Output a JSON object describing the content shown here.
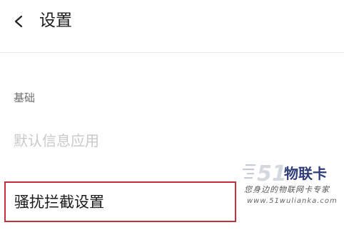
{
  "header": {
    "back_icon": "chevron-left-icon",
    "title": "设置"
  },
  "section": {
    "label": "基础"
  },
  "items": {
    "default_sms_app": "默认信息应用",
    "harassment_block": "骚扰拦截设置"
  },
  "watermark": {
    "brand": "51物联卡",
    "tagline": "您身边的物联网卡专家",
    "url": "www.51wulianka.com"
  },
  "colors": {
    "highlight_border": "#c0323a",
    "disabled_text": "#c9c9c9"
  }
}
